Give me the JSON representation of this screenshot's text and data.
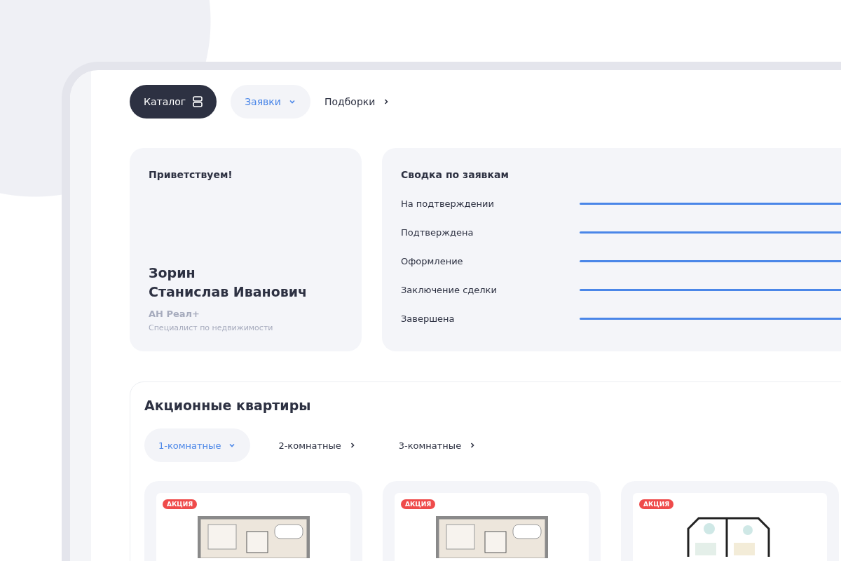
{
  "nav": [
    {
      "label": "Каталог",
      "kind": "primary"
    },
    {
      "label": "Заявки",
      "kind": "dropdown"
    },
    {
      "label": "Подборки",
      "kind": "link"
    }
  ],
  "greeting": {
    "title": "Приветствуем!",
    "surname": "Зорин",
    "name": "Станислав Иванович",
    "agency": "АН Реал+",
    "role": "Специалист по недвижимости"
  },
  "summary": {
    "title": "Сводка по заявкам",
    "rows": [
      "На подтверждении",
      "Подтверждена",
      "Оформление",
      "Заключение сделки",
      "Завершена"
    ]
  },
  "promo": {
    "title": "Акционные квартиры",
    "tabs": [
      {
        "label": "1-комнатные",
        "selected": true
      },
      {
        "label": "2-комнатные",
        "selected": false
      },
      {
        "label": "3-комнатные",
        "selected": false
      }
    ],
    "cards": [
      {
        "badge": "АКЦИЯ",
        "kind": "compact"
      },
      {
        "badge": "АКЦИЯ",
        "kind": "compact"
      },
      {
        "badge": "АКЦИЯ",
        "kind": "bay"
      }
    ]
  }
}
